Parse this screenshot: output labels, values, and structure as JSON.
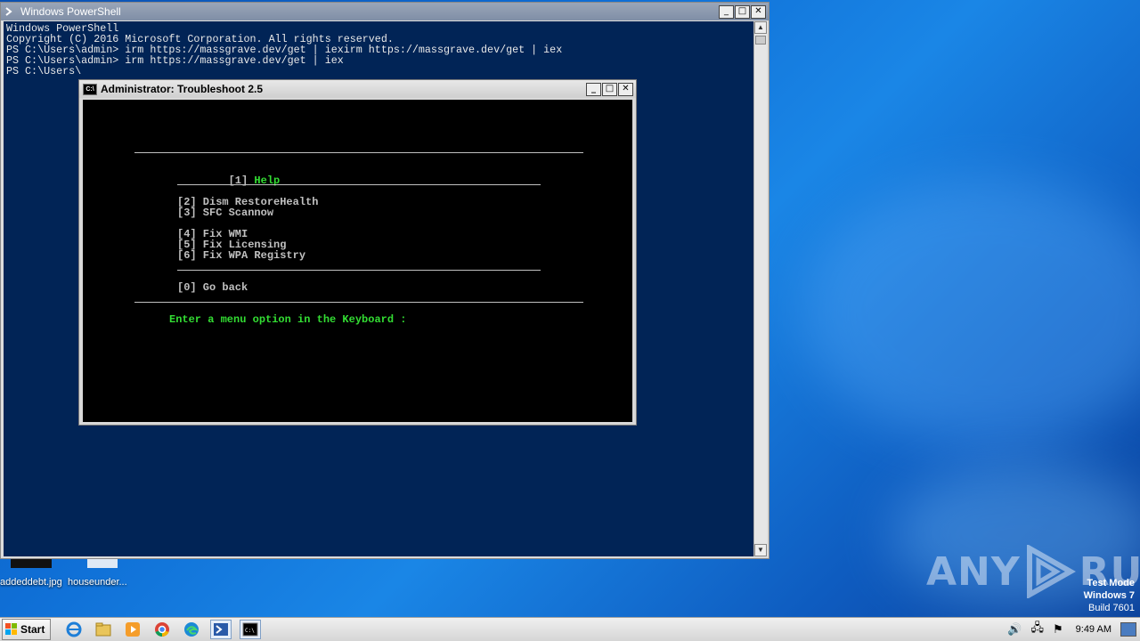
{
  "colors": {
    "desktop_blue": "#0f6fd6",
    "ps_background": "#012456",
    "cmd_background": "#000000",
    "cmd_text": "#c0c0c0",
    "cmd_accent_green": "#33dd33"
  },
  "powershell": {
    "title": "Windows PowerShell",
    "lines": [
      "Windows PowerShell",
      "Copyright (C) 2016 Microsoft Corporation. All rights reserved.",
      "",
      "PS C:\\Users\\admin> irm https://massgrave.dev/get | iexirm https://massgrave.dev/get | iex",
      "PS C:\\Users\\admin> irm https://massgrave.dev/get | iex",
      "PS C:\\Users\\"
    ]
  },
  "troubleshoot": {
    "title": "Administrator:  Troubleshoot 2.5",
    "menu": {
      "help": "[1] Help",
      "dism": "[2] Dism RestoreHealth",
      "sfc": "[3] SFC Scannow",
      "wmi": "[4] Fix WMI",
      "licensing": "[5] Fix Licensing",
      "wpa": "[6] Fix WPA Registry",
      "back": "[0] Go back"
    },
    "prompt": "Enter a menu option in the Keyboard :"
  },
  "desktop": {
    "icons": [
      {
        "label": "addeddebt.jpg"
      },
      {
        "label": "houseunder..."
      }
    ],
    "watermark": {
      "left": "ANY",
      "right": "RUN"
    },
    "test_mode": {
      "line1": "Test Mode",
      "line2": "Windows 7",
      "line3": "Build 7601"
    }
  },
  "taskbar": {
    "start_label": "Start",
    "icons": [
      "ie-icon",
      "explorer-icon",
      "media-player-icon",
      "chrome-icon",
      "edge-icon",
      "powershell-icon",
      "cmd-icon"
    ],
    "clock": "9:49 AM"
  }
}
